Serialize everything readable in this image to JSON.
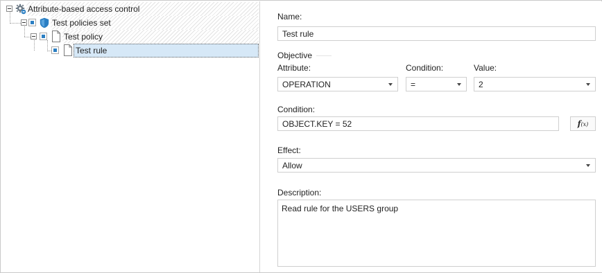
{
  "tree": {
    "nodes": [
      {
        "label": "Attribute-based access control",
        "icon": "gear-icon"
      },
      {
        "label": "Test policies set",
        "icon": "shield-icon"
      },
      {
        "label": "Test policy",
        "icon": "document-icon"
      },
      {
        "label": "Test rule",
        "icon": "document-icon",
        "selected": true
      }
    ]
  },
  "form": {
    "name_label": "Name:",
    "name_value": "Test rule",
    "objective_heading": "Objective",
    "attribute_label": "Attribute:",
    "attribute_value": "OPERATION",
    "condition_op_label": "Condition:",
    "condition_op_value": "=",
    "value_label": "Value:",
    "value_value": "2",
    "condition_label": "Condition:",
    "condition_value": "OBJECT.KEY = 52",
    "fx_label": "f",
    "fx_sub": "(x)",
    "effect_label": "Effect:",
    "effect_value": "Allow",
    "description_label": "Description:",
    "description_value": "Read rule for the USERS group"
  },
  "colors": {
    "accent": "#2b7fc3",
    "selection": "#d6e8f7",
    "border": "#cfcfcf"
  }
}
